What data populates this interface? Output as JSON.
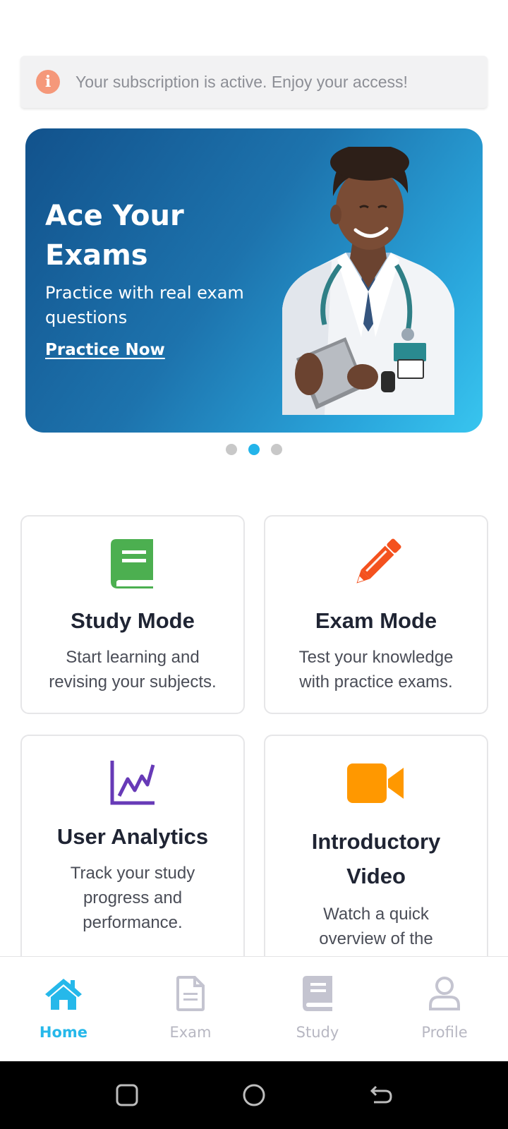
{
  "notice": {
    "icon": "info-icon",
    "text": "Your subscription is active. Enjoy your access!"
  },
  "banner": {
    "title": "Ace Your Exams",
    "subtitle": "Practice with real exam questions",
    "cta": "Practice Now",
    "image": "doctor-with-tablet-illustration",
    "gradient": [
      "#12528c",
      "#38c5ef"
    ]
  },
  "carousel": {
    "total": 3,
    "active_index": 1
  },
  "cards": [
    {
      "title": "Study Mode",
      "description": "Start learning and revising your subjects.",
      "icon": "book-icon",
      "color": "#4caf50"
    },
    {
      "title": "Exam Mode",
      "description": "Test your knowledge with practice exams.",
      "icon": "pencil-icon",
      "color": "#f4511e"
    },
    {
      "title": "User Analytics",
      "description": "Track your study progress and performance.",
      "icon": "chart-line-icon",
      "color": "#673ab7"
    },
    {
      "title": "Introductory Video",
      "description": "Watch a quick overview of the platform.",
      "icon": "video-camera-icon",
      "color": "#ff9800"
    }
  ],
  "nav": {
    "items": [
      {
        "label": "Home",
        "icon": "home-icon",
        "active": true
      },
      {
        "label": "Exam",
        "icon": "document-icon",
        "active": false
      },
      {
        "label": "Study",
        "icon": "book-icon",
        "active": false
      },
      {
        "label": "Profile",
        "icon": "user-icon",
        "active": false
      }
    ],
    "active_color": "#26b8ea",
    "inactive_color": "#c4c4d0"
  },
  "system_nav": {
    "buttons": [
      "recent-apps-icon",
      "home-circle-icon",
      "back-icon"
    ]
  }
}
